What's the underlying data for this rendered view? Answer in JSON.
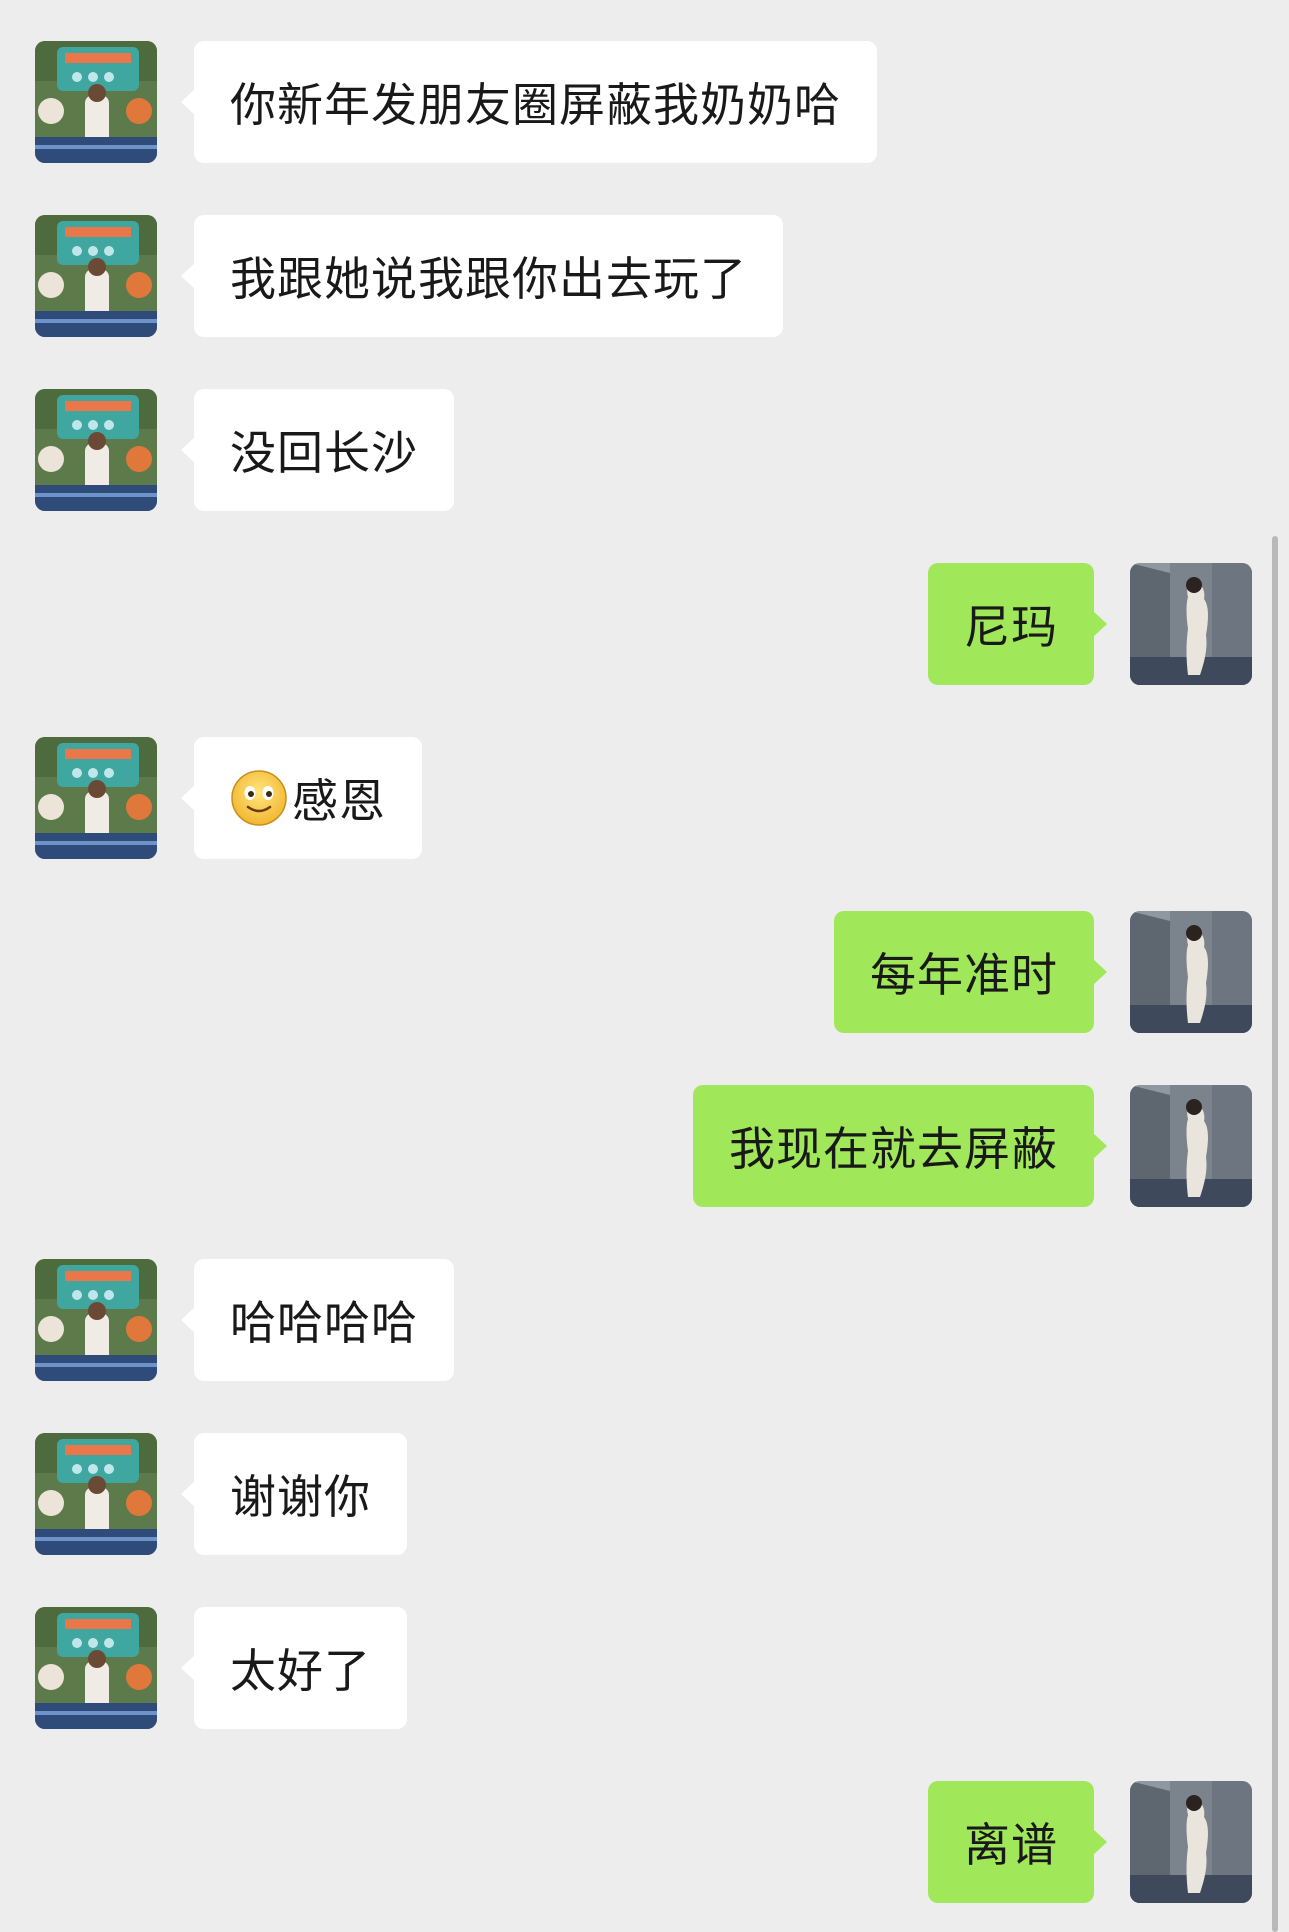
{
  "messages": [
    {
      "side": "in",
      "text": "你新年发朋友圈屏蔽我奶奶哈"
    },
    {
      "side": "in",
      "text": "我跟她说我跟你出去玩了"
    },
    {
      "side": "in",
      "text": "没回长沙"
    },
    {
      "side": "out",
      "text": "尼玛"
    },
    {
      "side": "in",
      "text": "感恩",
      "emoji": "smiling-face-icon"
    },
    {
      "side": "out",
      "text": "每年准时"
    },
    {
      "side": "out",
      "text": "我现在就去屏蔽"
    },
    {
      "side": "in",
      "text": "哈哈哈哈"
    },
    {
      "side": "in",
      "text": "谢谢你"
    },
    {
      "side": "in",
      "text": "太好了"
    },
    {
      "side": "out",
      "text": "离谱"
    }
  ],
  "colors": {
    "background": "#ededed",
    "incoming_bubble": "#ffffff",
    "outgoing_bubble": "#a0e75a",
    "text": "#191919"
  }
}
